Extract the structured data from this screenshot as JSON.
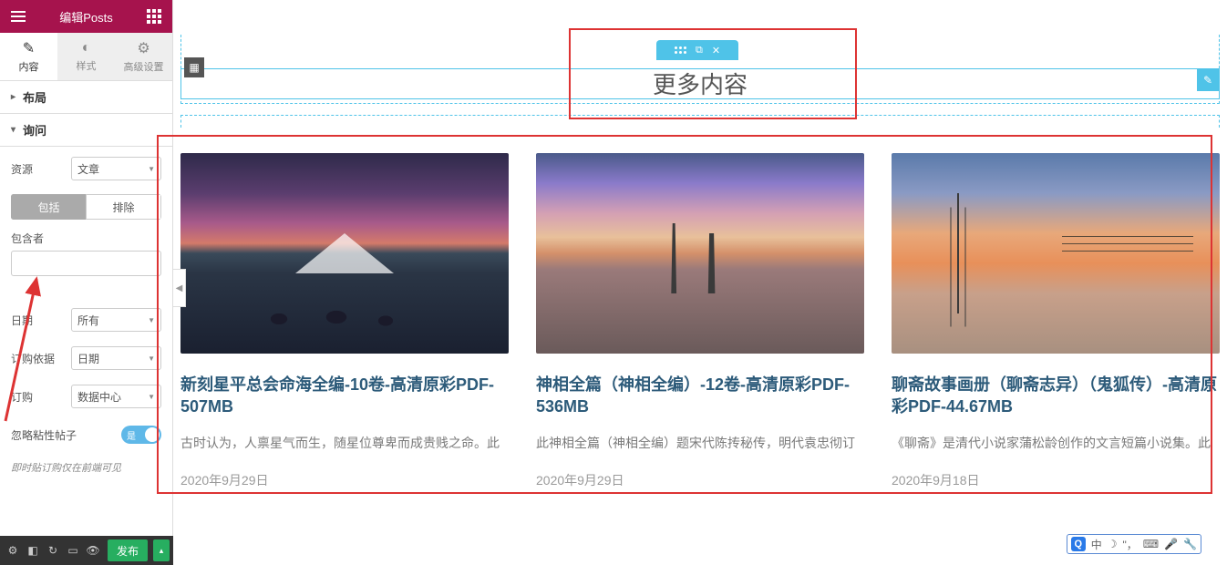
{
  "sidebar": {
    "header_title": "编辑Posts",
    "tabs": [
      {
        "label": "内容"
      },
      {
        "label": "样式"
      },
      {
        "label": "高级设置"
      }
    ],
    "section_layout": "布局",
    "section_query": "询问",
    "source_label": "资源",
    "source_value": "文章",
    "include_label": "包括",
    "exclude_label": "排除",
    "by_label": "包含者",
    "by_value": "",
    "date_label": "日期",
    "date_value": "所有",
    "orderby_label": "订购依据",
    "orderby_value": "日期",
    "order_label": "订购",
    "order_value": "数据中心",
    "sticky_label": "忽略粘性帖子",
    "sticky_toggle": "是",
    "sticky_note": "即时贴订购仅在前端可见",
    "publish": "发布"
  },
  "canvas": {
    "heading": "更多内容",
    "posts": [
      {
        "title": "新刻星平总会命海全编-10卷-高清原彩PDF-507MB",
        "excerpt": "古时认为，人禀星气而生，随星位尊卑而成贵贱之命。此",
        "date": "2020年9月29日"
      },
      {
        "title": "神相全篇（神相全编）-12卷-高清原彩PDF-536MB",
        "excerpt": "此神相全篇（神相全编）题宋代陈抟秘传，明代袁忠彻订",
        "date": "2020年9月29日"
      },
      {
        "title": "聊斋故事画册（聊斋志异）（鬼狐传）-高清原彩PDF-44.67MB",
        "excerpt": "《聊斋》是清代小说家蒲松龄创作的文言短篇小说集。此",
        "date": "2020年9月18日"
      }
    ]
  },
  "ime": {
    "q": "Q",
    "lang": "中",
    "moon": "☽",
    "comma": "\"，",
    "kb": "⌨",
    "mic": "🎤",
    "tool": "🔧"
  }
}
